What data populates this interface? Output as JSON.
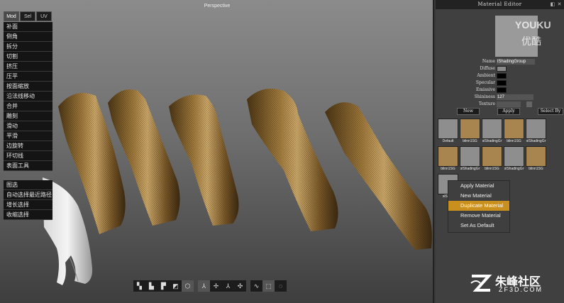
{
  "viewport": {
    "title": "Perspective",
    "tabs": [
      {
        "label": "Mod",
        "active": true
      },
      {
        "label": "Sel",
        "active": false
      },
      {
        "label": "UV",
        "active": false
      }
    ],
    "tools": [
      "补面",
      "倒角",
      "拆分",
      "切割",
      "挤压",
      "压平",
      "按面缩放",
      "沿法线移动",
      "合并",
      "雕刻",
      "滑动",
      "平滑",
      "边旋转",
      "环切线",
      "表面工具"
    ],
    "select_tools": [
      "图选",
      "自动选择最近路径",
      "增长选择",
      "收缩选择"
    ]
  },
  "toolbar": {
    "groups": [
      [
        "cube-front-icon",
        "cube-side-icon",
        "cube-top-icon",
        "cube-corner-icon",
        "hexagon-icon"
      ],
      [
        "axis-icon",
        "axis-rotate-icon",
        "axis-scale-icon",
        "axis-combined-icon"
      ],
      [
        "curve-icon",
        "marquee-icon",
        "lasso-icon"
      ]
    ],
    "active": [
      4,
      1
    ]
  },
  "material_editor": {
    "title": "Material Editor",
    "title_controls": "◧ ✕",
    "properties": {
      "name_label": "Name",
      "name_value": "lShadingGroup",
      "diffuse_label": "Diffuse",
      "ambient_label": "Ambient",
      "specular_label": "Specular",
      "emissive_label": "Emissive",
      "shininess_label": "Shininess",
      "shininess_value": "127",
      "texture_label": "Texture"
    },
    "colors": {
      "diffuse": "#8a8a8a",
      "ambient": "#000000",
      "specular": "#000000",
      "emissive": "#000000",
      "gray_material": "#8e8e8e",
      "tan_material": "#a8844f",
      "preview": "#9a9a9a",
      "highlight": "#c9901d"
    },
    "buttons": {
      "new": "New",
      "apply": "Apply",
      "select_by": "Select By"
    },
    "materials": [
      {
        "name": "Default",
        "color": "gray"
      },
      {
        "name": "blinn1SG",
        "color": "tan"
      },
      {
        "name": "slShadingGr",
        "color": "gray"
      },
      {
        "name": "blinn1SG",
        "color": "tan"
      },
      {
        "name": "slShadingGr",
        "color": "gray"
      },
      {
        "name": "blinn1SG",
        "color": "tan"
      },
      {
        "name": "slShadingGr",
        "color": "gray"
      },
      {
        "name": "blinn1SG",
        "color": "tan"
      },
      {
        "name": "slShadingGr",
        "color": "gray"
      },
      {
        "name": "blinn1SG",
        "color": "tan"
      },
      {
        "name": "slShad",
        "color": "gray"
      }
    ],
    "context_menu": [
      {
        "label": "Apply Material",
        "highlight": false
      },
      {
        "label": "New Material",
        "highlight": false
      },
      {
        "label": "Duplicate Material",
        "highlight": true
      },
      {
        "label": "Remove Material",
        "highlight": false
      },
      {
        "label": "Set As Default",
        "highlight": false
      }
    ]
  },
  "watermarks": {
    "youku": "YOUKU",
    "youku_cn": "优酷",
    "site_cn": "朱峰社区",
    "site_url": "ZF3D.COM"
  }
}
